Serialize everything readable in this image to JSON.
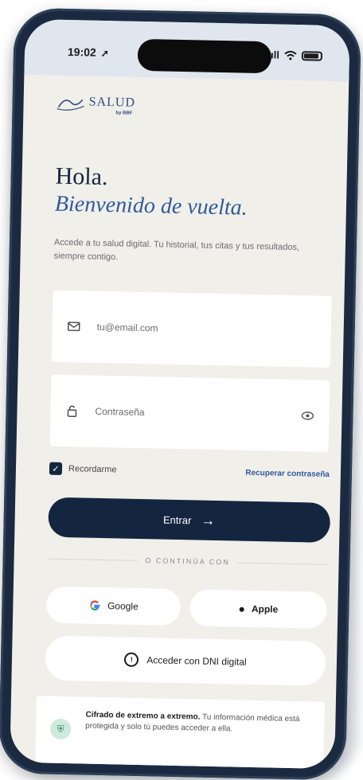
{
  "status_bar": {
    "time": "19:02",
    "location_icon": "location-arrow-icon",
    "signal_text": "ıll",
    "wifi_icon": "wifi-icon",
    "battery_icon": "battery-icon"
  },
  "brand": {
    "logo_text": "SALUD",
    "logo_sub": "by BBF"
  },
  "heading": {
    "greeting": "Hola.",
    "welcome": "Bienvenido de vuelta.",
    "subtitle": "Accede a tu salud digital. Tu historial, tus citas y tus resultados, siempre contigo."
  },
  "form": {
    "email_placeholder": "tu@email.com",
    "password_placeholder": "Contraseña",
    "remember_label": "Recordarme",
    "forgot_label": "Recuperar contraseña",
    "submit_label": "Entrar"
  },
  "divider": {
    "label": "O CONTINÚA CON"
  },
  "social": {
    "google_label": "Google",
    "apple_label": "Apple",
    "dni_label": "Acceder con DNI digital"
  },
  "security": {
    "title": "Cifrado de extremo a extremo.",
    "body": "Tu información médica está protegida y solo tú puedes acceder a ella."
  },
  "colors": {
    "primary": "#14253f",
    "accent": "#2f5a9a",
    "background": "#f1efea",
    "secure_green": "#2e8a62"
  }
}
